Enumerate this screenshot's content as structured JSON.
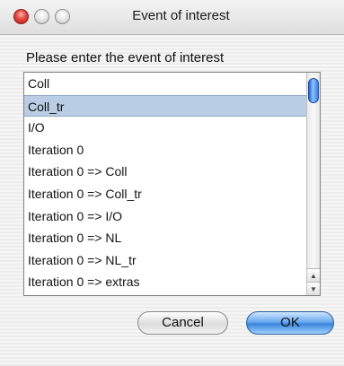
{
  "window": {
    "title": "Event of interest"
  },
  "dialog": {
    "prompt": "Please enter the event of interest",
    "items": [
      "Coll",
      "Coll_tr",
      "I/O",
      "Iteration 0",
      "Iteration 0 => Coll",
      "Iteration 0 => Coll_tr",
      "Iteration 0 => I/O",
      "Iteration 0 => NL",
      "Iteration 0 => NL_tr",
      "Iteration 0 => extras"
    ],
    "selected_item": "Coll_tr",
    "cancel_label": "Cancel",
    "ok_label": "OK"
  },
  "icons": {
    "close": "close-icon",
    "minimize": "minimize-icon",
    "zoom": "zoom-icon",
    "scroll_up": "arrow-up-icon",
    "scroll_down": "arrow-down-icon"
  },
  "colors": {
    "selection": "#b9cde4",
    "default_button": "#3a86dd"
  }
}
